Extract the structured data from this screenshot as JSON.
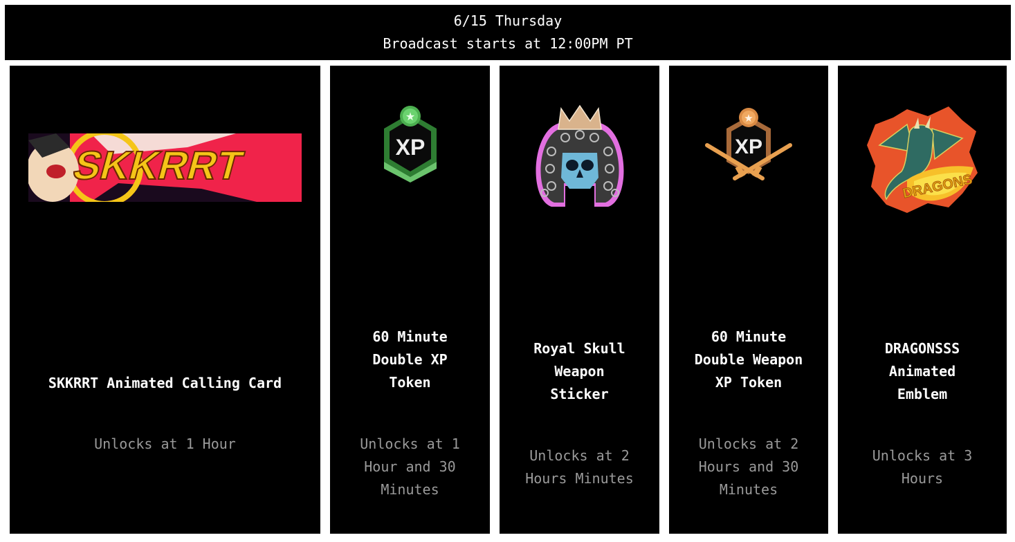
{
  "header": {
    "date": "6/15 Thursday",
    "broadcast": "Broadcast starts at 12:00PM PT"
  },
  "rewards": [
    {
      "name": "SKKRRT Animated Calling Card",
      "unlock": "Unlocks at 1 Hour",
      "image": "skkrrt-calling-card-art",
      "image_text": "SKKRRT"
    },
    {
      "name": "60 Minute Double XP Token",
      "name_lines": [
        "60 Minute",
        "Double XP",
        "Token"
      ],
      "unlock": "Unlocks at 1 Hour and 30 Minutes",
      "unlock_lines": [
        "Unlocks at 1",
        "Hour and 30",
        "Minutes"
      ],
      "image": "double-xp-token-icon",
      "image_text": "XP"
    },
    {
      "name": "Royal Skull Weapon Sticker",
      "name_lines": [
        "Royal Skull",
        "Weapon",
        "Sticker"
      ],
      "unlock": "Unlocks at 2 Hours Minutes",
      "unlock_lines": [
        "Unlocks at 2",
        "Hours Minutes"
      ],
      "image": "royal-skull-sticker-art"
    },
    {
      "name": "60 Minute Double Weapon XP Token",
      "name_lines": [
        "60 Minute",
        "Double Weapon",
        "XP Token"
      ],
      "unlock": "Unlocks at 2 Hours and 30 Minutes",
      "unlock_lines": [
        "Unlocks at 2",
        "Hours and 30",
        "Minutes"
      ],
      "image": "double-weapon-xp-token-icon",
      "image_text": "XP"
    },
    {
      "name": "DRAGONSSS Animated Emblem",
      "name_lines": [
        "DRAGONSSS",
        "Animated",
        "Emblem"
      ],
      "unlock": "Unlocks at 3 Hours",
      "unlock_lines": [
        "Unlocks at 3",
        "Hours"
      ],
      "image": "dragonsss-emblem-art",
      "image_text": "DRAGONS"
    }
  ],
  "colors": {
    "background": "#000000",
    "gutter": "#ffffff",
    "title": "#ffffff",
    "unlock": "#9a9a9a",
    "xp_green": "#3fa14a",
    "xp_bronze": "#c98a4a",
    "card_red": "#f0234a",
    "card_yellow": "#f5c518"
  }
}
